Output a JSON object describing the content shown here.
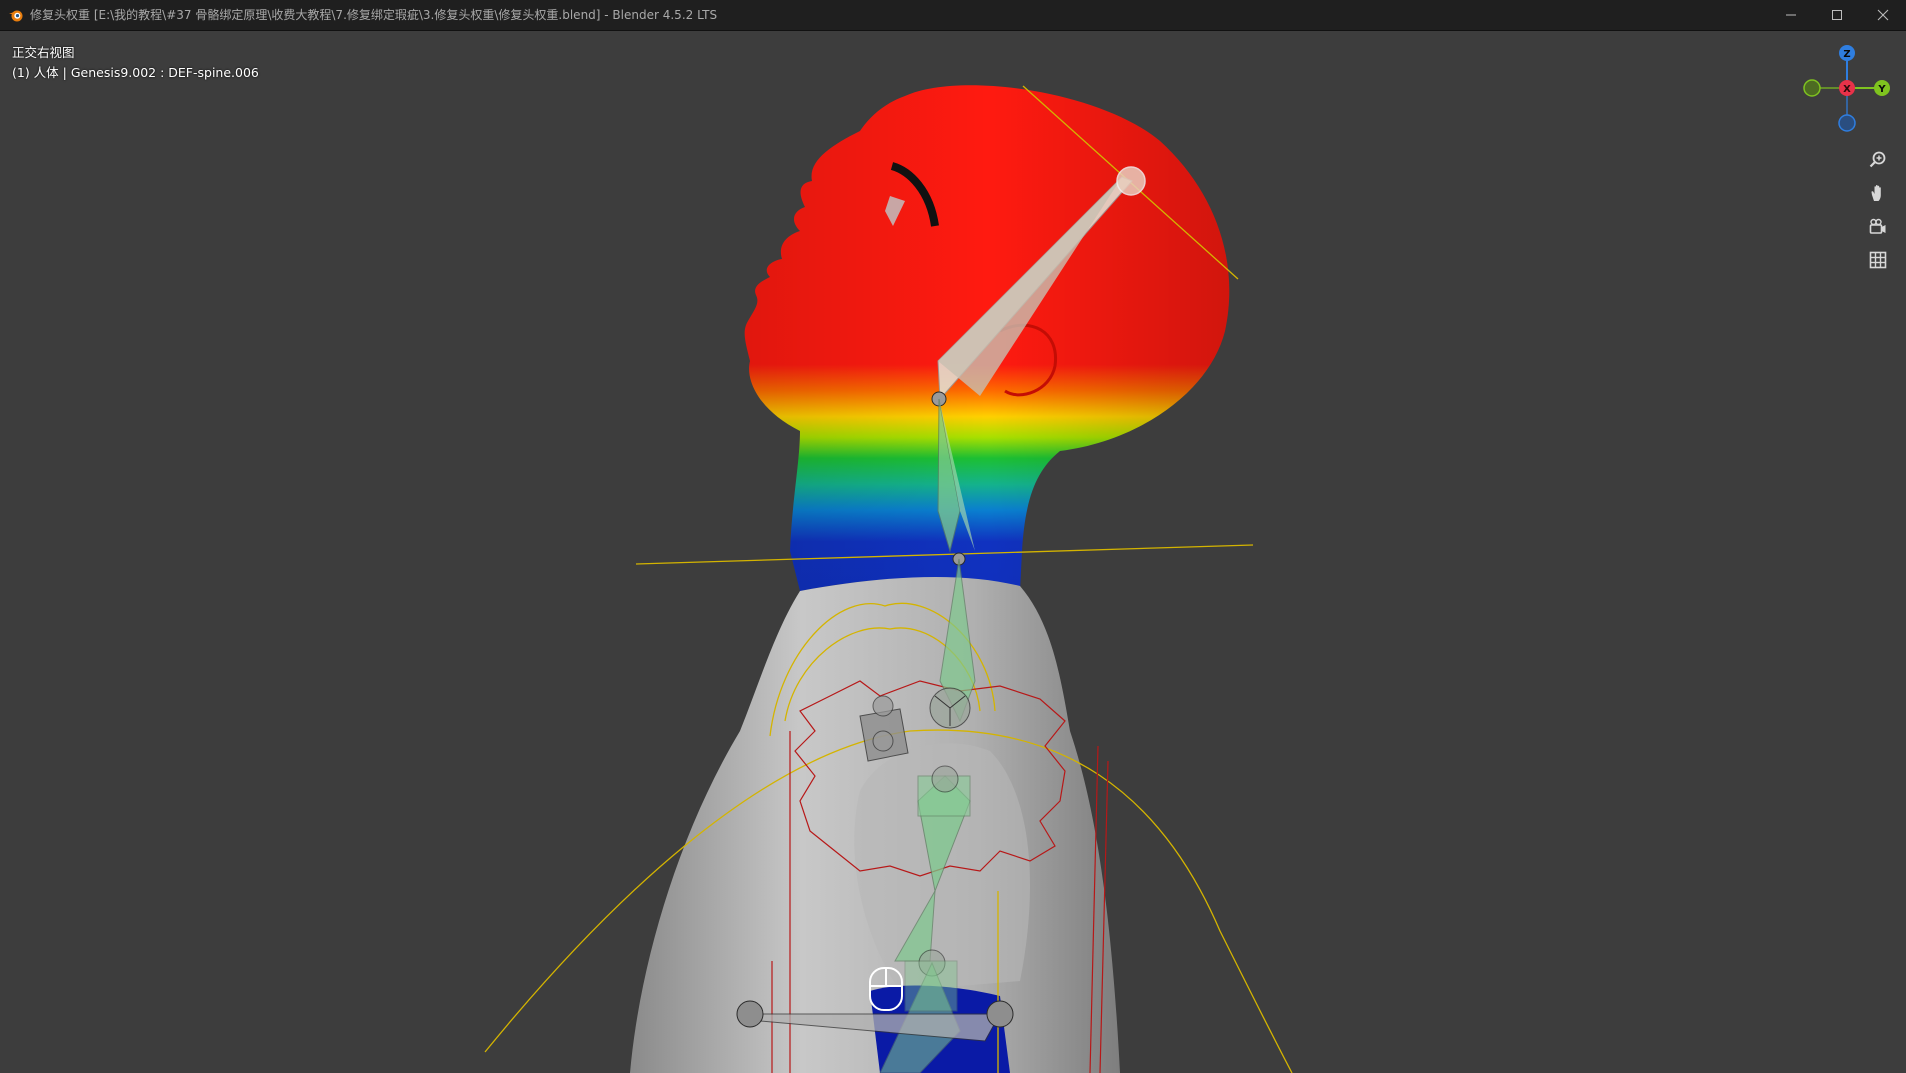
{
  "window": {
    "title": "修复头权重 [E:\\我的教程\\#37 骨骼绑定原理\\收费大教程\\7.修复绑定瑕疵\\3.修复头权重\\修复头权重.blend] - Blender 4.5.2 LTS",
    "app_icon": "blender-logo",
    "controls": [
      "minimize-icon",
      "maximize-icon",
      "close-icon"
    ]
  },
  "viewport": {
    "view_name": "正交右视图",
    "object_info": "(1) 人体 | Genesis9.002 : DEF-spine.006",
    "mode": "weight-paint",
    "gizmo_axes": {
      "z": {
        "label": "Z",
        "color": "#2f7ee0"
      },
      "x": {
        "label": "X",
        "color": "#e83249"
      },
      "y": {
        "label": "Y",
        "color": "#7fc31f"
      }
    },
    "nav_buttons": [
      "zoom-icon",
      "pan-hand-icon",
      "camera-icon",
      "grid-icon"
    ]
  }
}
